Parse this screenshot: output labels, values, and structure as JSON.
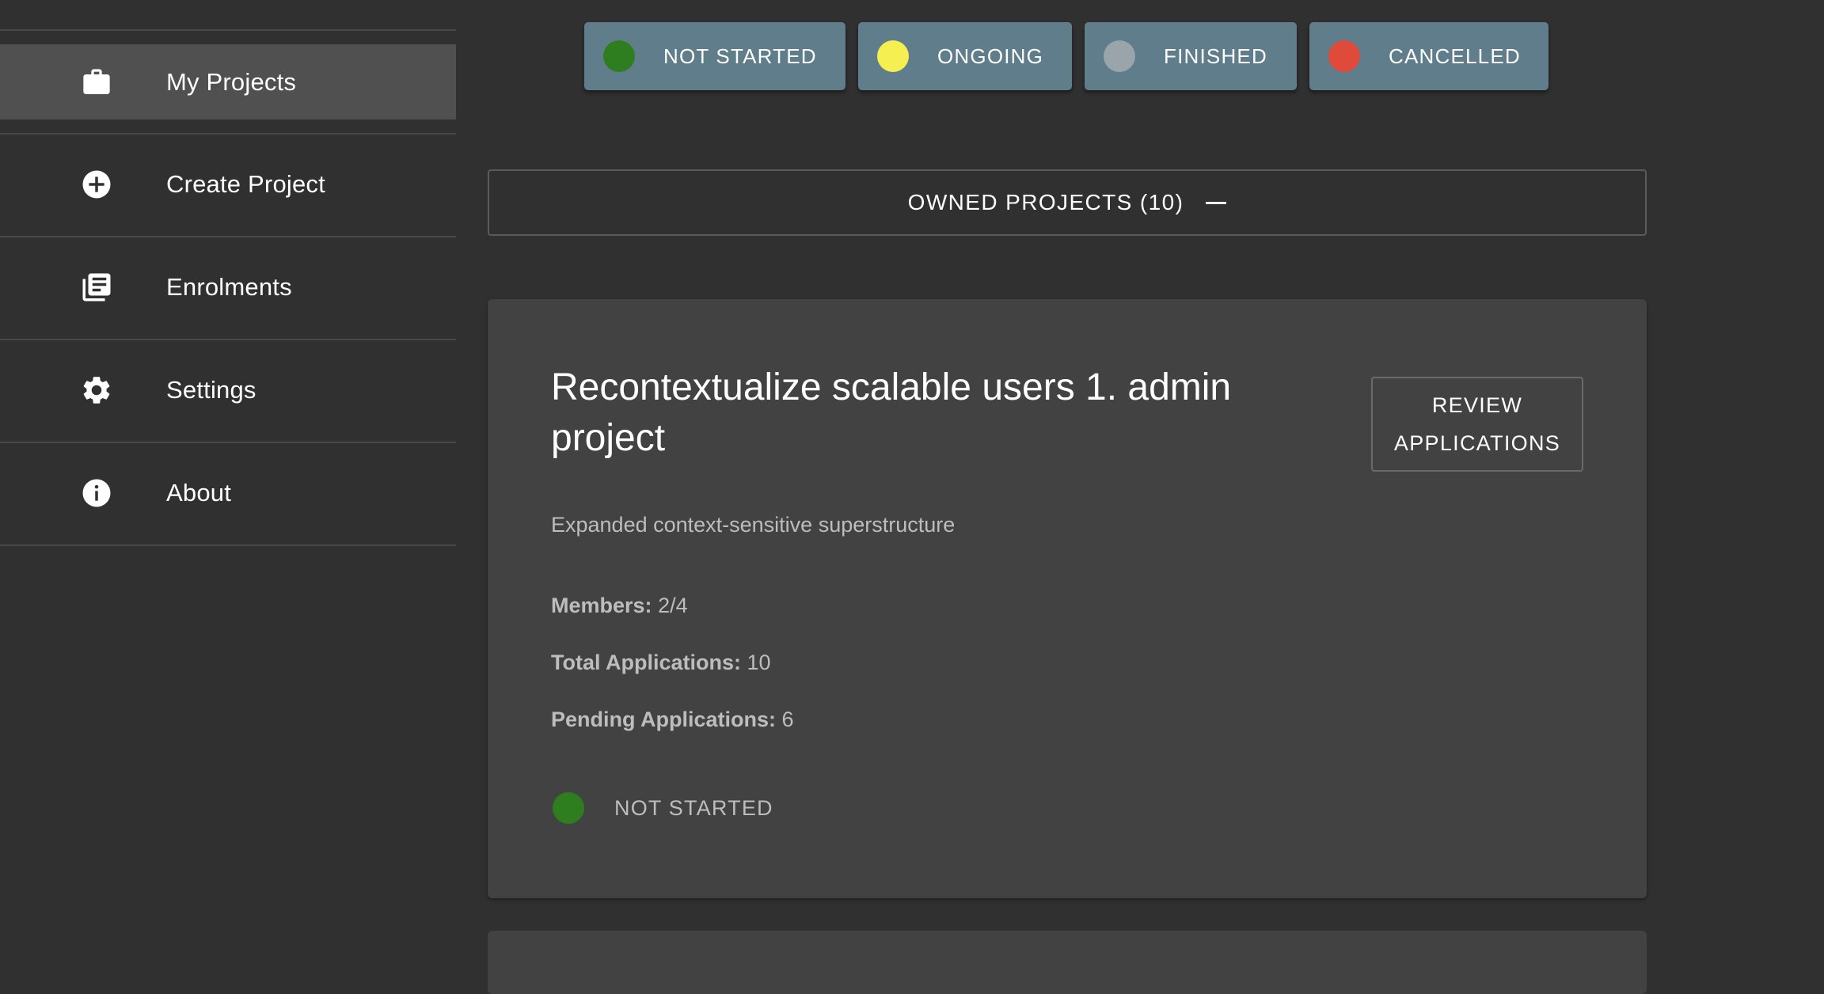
{
  "sidebar": {
    "items": [
      {
        "label": "My Projects",
        "icon": "briefcase-icon",
        "active": true
      },
      {
        "label": "Create Project",
        "icon": "add-circle-icon",
        "active": false
      },
      {
        "label": "Enrolments",
        "icon": "library-books-icon",
        "active": false
      },
      {
        "label": "Settings",
        "icon": "gear-icon",
        "active": false
      },
      {
        "label": "About",
        "icon": "info-icon",
        "active": false
      }
    ]
  },
  "filters": [
    {
      "label": "NOT STARTED",
      "color": "#2e7d1f"
    },
    {
      "label": "ONGOING",
      "color": "#f5ef52"
    },
    {
      "label": "FINISHED",
      "color": "#9aa4ab"
    },
    {
      "label": "CANCELLED",
      "color": "#e04a3a"
    }
  ],
  "owned": {
    "label": "OWNED PROJECTS (10)"
  },
  "project": {
    "title": "Recontextualize scalable users 1. admin project",
    "review_label": "REVIEW APPLICATIONS",
    "description": "Expanded context-sensitive superstructure",
    "members_label": "Members:",
    "members_value": "2/4",
    "total_label": "Total Applications:",
    "total_value": "10",
    "pending_label": "Pending Applications:",
    "pending_value": "6",
    "status_label": "NOT STARTED",
    "status_color": "#2e7d1f"
  }
}
